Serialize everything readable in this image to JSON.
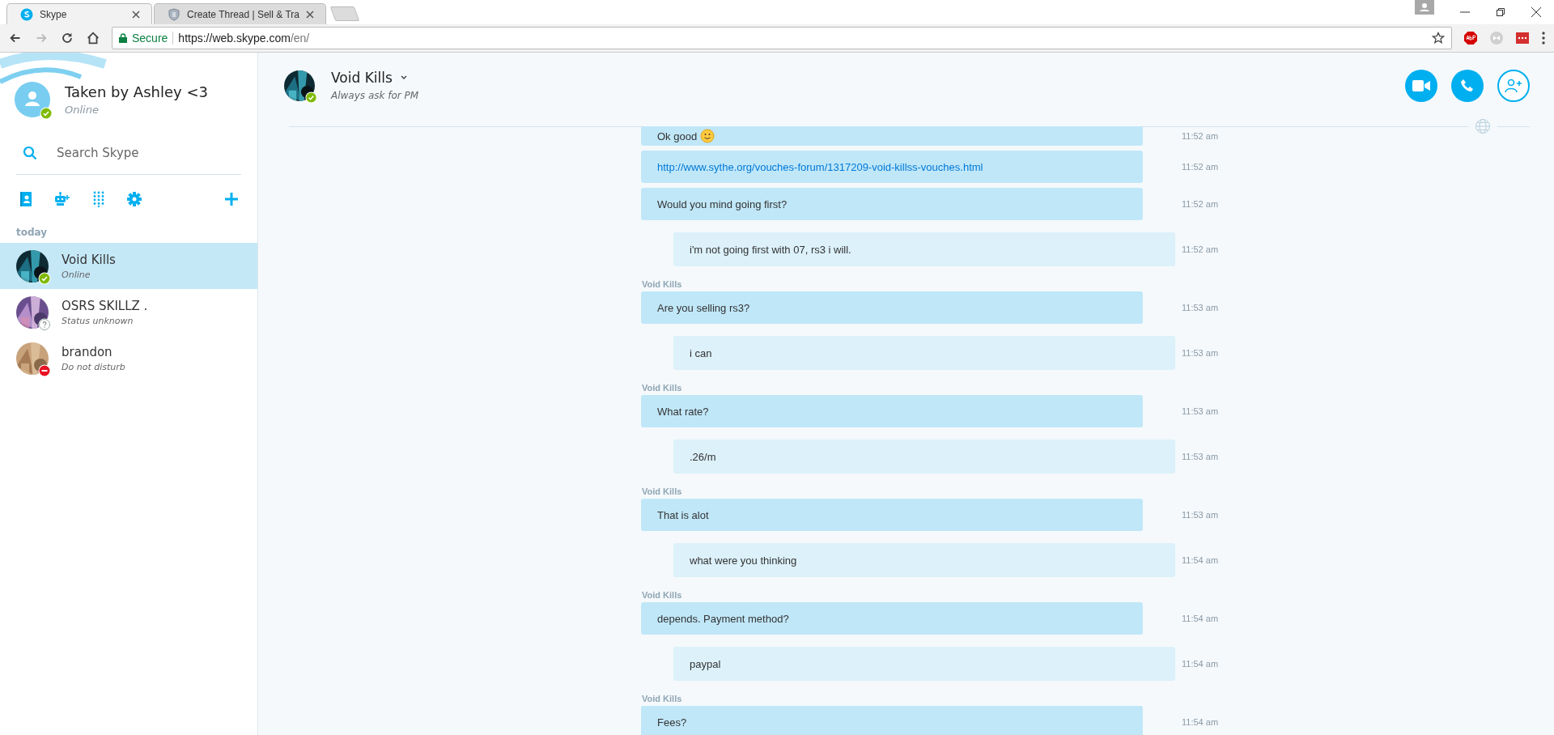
{
  "browser": {
    "tabs": [
      {
        "title": "Skype",
        "kind": "skype",
        "selected": true
      },
      {
        "title": "Create Thread | Sell & Tra",
        "kind": "shield",
        "selected": false
      }
    ],
    "address": {
      "security": "Secure",
      "host": "https://web.skype.com",
      "path": "/en/"
    }
  },
  "profile": {
    "name": "Taken by Ashley <3",
    "status": "Online",
    "color": "#7fba00"
  },
  "search": {
    "placeholder": "Search Skype"
  },
  "recents": {
    "heading": "today",
    "contacts": [
      {
        "name": "Void Kills",
        "status": "Online",
        "color": "#7fba00",
        "selected": true
      },
      {
        "name": "OSRS SKILLZ .",
        "status": "Status unknown",
        "color": "#ffffff",
        "selected": false
      },
      {
        "name": "brandon",
        "status": "Do not disturb",
        "color": "#e81123",
        "selected": false
      }
    ]
  },
  "chat": {
    "name": "Void Kills",
    "mood": "Always ask for PM",
    "color": "#7fba00",
    "messages": [
      {
        "kind": "incoming",
        "text": "Ok good",
        "time": "11:52 am",
        "link": false,
        "emoji": true
      },
      {
        "kind": "incoming",
        "text": "http://www.sythe.org/vouches-forum/1317209-void-killss-vouches.html",
        "time": "11:52 am",
        "link": true,
        "emoji": false
      },
      {
        "kind": "incoming",
        "text": "Would you mind going first?",
        "time": "11:52 am",
        "link": false,
        "emoji": false
      },
      {
        "kind": "outgoing",
        "text": "i'm not going first with 07, rs3 i will.",
        "time": "11:52 am",
        "link": false,
        "emoji": false
      },
      {
        "kind": "incoming",
        "sender": "Void Kills",
        "text": "Are you selling rs3?",
        "time": "11:53 am",
        "link": false,
        "emoji": false
      },
      {
        "kind": "outgoing",
        "text": "i can",
        "time": "11:53 am",
        "link": false,
        "emoji": false
      },
      {
        "kind": "incoming",
        "sender": "Void Kills",
        "text": "What rate?",
        "time": "11:53 am",
        "link": false,
        "emoji": false
      },
      {
        "kind": "outgoing",
        "text": ".26/m",
        "time": "11:53 am",
        "link": false,
        "emoji": false
      },
      {
        "kind": "incoming",
        "sender": "Void Kills",
        "text": "That is alot",
        "time": "11:53 am",
        "link": false,
        "emoji": false
      },
      {
        "kind": "outgoing",
        "text": "what were you thinking",
        "time": "11:54 am",
        "link": false,
        "emoji": false
      },
      {
        "kind": "incoming",
        "sender": "Void Kills",
        "text": "depends. Payment method?",
        "time": "11:54 am",
        "link": false,
        "emoji": false
      },
      {
        "kind": "outgoing",
        "text": "paypal",
        "time": "11:54 am",
        "link": false,
        "emoji": false
      },
      {
        "kind": "incoming",
        "sender": "Void Kills",
        "text": "Fees?",
        "time": "11:54 am",
        "link": false,
        "emoji": false
      }
    ]
  }
}
